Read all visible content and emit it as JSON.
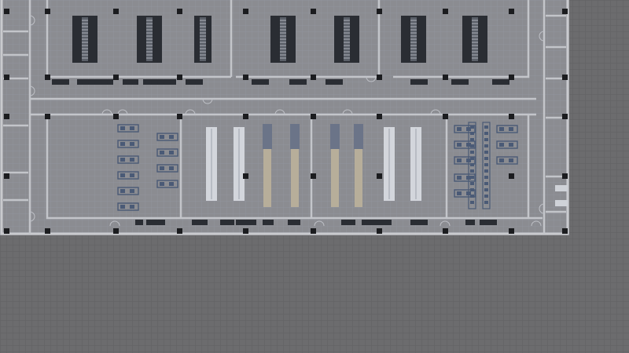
{
  "view": {
    "mode": "top-down-editor",
    "grid_visible": true
  },
  "colors": {
    "ground": "#6c6c6e",
    "ground_grid": "#626264",
    "floor": "#8b8c91",
    "floor_grid": "#9296a0",
    "wall": "#c9cace",
    "pillar": "#1b1c1f",
    "furniture_dark": "#2a2d33",
    "furniture_light": "#d3d6dc",
    "furniture_blue": "#6b7488",
    "furniture_tan": "#b7ae9a",
    "desk_blue": "#4a5a76"
  },
  "rooms": [
    {
      "id": "north-hall-west",
      "kind": "server-hall"
    },
    {
      "id": "north-hall-east",
      "kind": "server-hall"
    },
    {
      "id": "corridor",
      "kind": "corridor"
    },
    {
      "id": "south-office-west",
      "kind": "office"
    },
    {
      "id": "south-storage-center",
      "kind": "storage"
    },
    {
      "id": "south-storage-east",
      "kind": "storage"
    },
    {
      "id": "south-office-east",
      "kind": "office"
    }
  ],
  "counts": {
    "server_racks": 7,
    "storage_racks": 8,
    "desk_clusters": 18
  }
}
